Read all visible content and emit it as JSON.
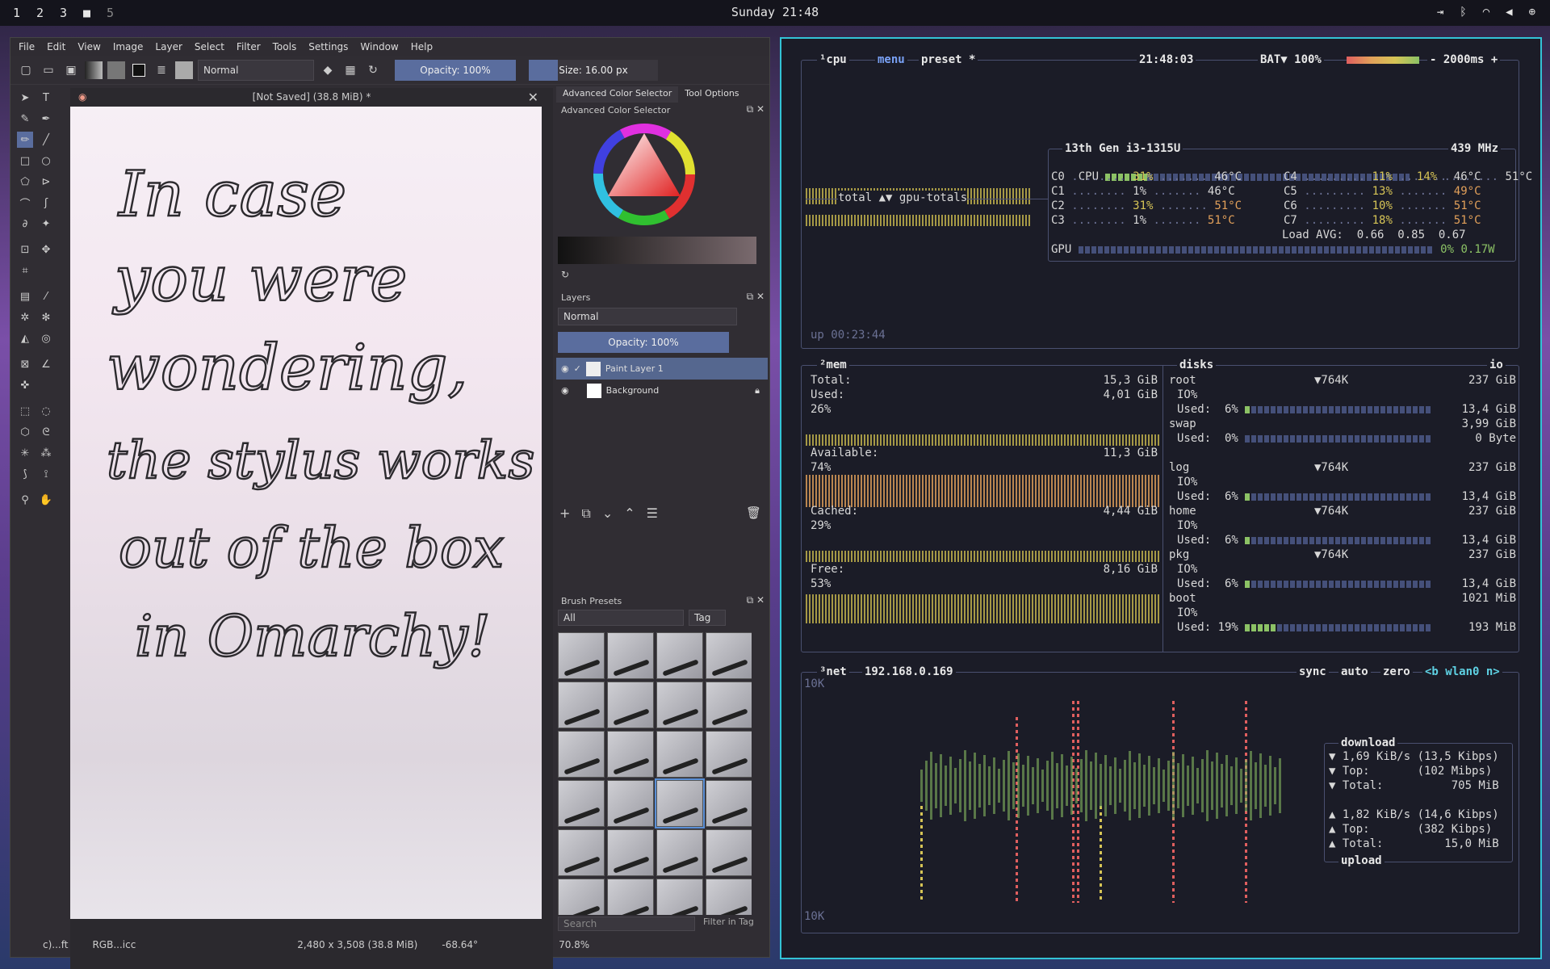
{
  "topbar": {
    "workspaces": [
      "1",
      "2",
      "3",
      "■",
      "5"
    ],
    "clock": "Sunday 21:48"
  },
  "krita": {
    "menu": [
      "File",
      "Edit",
      "View",
      "Image",
      "Layer",
      "Select",
      "Filter",
      "Tools",
      "Settings",
      "Window",
      "Help"
    ],
    "blend_mode": "Normal",
    "opacity": "Opacity: 100%",
    "size": "Size: 16.00 px",
    "doc_title": "[Not Saved]  (38.8 MiB) *",
    "handwriting": [
      "In case",
      "you were",
      "wondering,",
      "the stylus works",
      "out of the box",
      "in Omarchy!"
    ],
    "dock_tabs": [
      "Advanced Color Selector",
      "Tool Options"
    ],
    "color_selector_title": "Advanced Color Selector",
    "layers_title": "Layers",
    "layers_blend": "Normal",
    "layers_opacity": "Opacity:  100%",
    "layers": [
      {
        "name": "Paint Layer 1"
      },
      {
        "name": "Background"
      }
    ],
    "brush_title": "Brush Presets",
    "brush_filter": "All",
    "brush_tag": "Tag",
    "brush_search": "Search",
    "filter_in_tag": "Filter in Tag",
    "status": {
      "left": "c)...ft",
      "profile": "RGB...icc",
      "dims": "2,480 x 3,508 (38.8 MiB)",
      "angle": "-68.64°",
      "zoom": "70.8%"
    }
  },
  "btop": {
    "cpu": {
      "tabs": [
        "¹cpu",
        "menu",
        "preset *"
      ],
      "time": "21:48:03",
      "bat": "BAT▼ 100%",
      "interval": "- 2000ms +",
      "model": "13th Gen i3-1315U",
      "freq": "439 MHz",
      "total_label": "total ▲▼ gpu-totals",
      "cores": [
        {
          "n": "CPU",
          "p": "14%",
          "t": "51°C"
        },
        {
          "n": "C0",
          "p": "31%",
          "t": "46°C"
        },
        {
          "n": "C1",
          "p": "1%",
          "t": "46°C"
        },
        {
          "n": "C2",
          "p": "31%",
          "t": "51°C"
        },
        {
          "n": "C3",
          "p": "1%",
          "t": "51°C"
        },
        {
          "n": "C4",
          "p": "11%",
          "t": "46°C"
        },
        {
          "n": "C5",
          "p": "13%",
          "t": "49°C"
        },
        {
          "n": "C6",
          "p": "10%",
          "t": "51°C"
        },
        {
          "n": "C7",
          "p": "18%",
          "t": "51°C"
        }
      ],
      "load_label": "Load AVG:",
      "load": [
        "0.66",
        "0.85",
        "0.67"
      ],
      "gpu": "GPU",
      "gpu_pct": "0%",
      "gpu_w": "0.17W",
      "uptime": "up 00:23:44"
    },
    "mem": {
      "title": "²mem",
      "total_l": "Total:",
      "total": "15,3 GiB",
      "used_l": "Used:",
      "used": "4,01 GiB",
      "used_p": "26%",
      "avail_l": "Available:",
      "avail": "11,3 GiB",
      "avail_p": "74%",
      "cached_l": "Cached:",
      "cached": "4,44 GiB",
      "cached_p": "29%",
      "free_l": "Free:",
      "free": "8,16 GiB",
      "free_p": "53%"
    },
    "disks": {
      "title": "disks",
      "io": "io",
      "items": [
        {
          "name": "root",
          "io": "▼764K",
          "size": "237 GiB",
          "used": "Used:  6%",
          "u": "13,4 GiB"
        },
        {
          "name": "swap",
          "io": "",
          "size": "3,99 GiB",
          "used": "Used:  0%",
          "u": "0 Byte"
        },
        {
          "name": "log",
          "io": "▼764K",
          "size": "237 GiB",
          "used": "Used:  6%",
          "u": "13,4 GiB"
        },
        {
          "name": "home",
          "io": "▼764K",
          "size": "237 GiB",
          "used": "Used:  6%",
          "u": "13,4 GiB"
        },
        {
          "name": "pkg",
          "io": "▼764K",
          "size": "237 GiB",
          "used": "Used:  6%",
          "u": "13,4 GiB"
        },
        {
          "name": "boot",
          "io": "",
          "size": "1021 MiB",
          "used": "Used: 19%",
          "u": "193 MiB"
        }
      ],
      "io_label": "IO%"
    },
    "net": {
      "title": "³net",
      "ip": "192.168.0.169",
      "sync": "sync",
      "auto": "auto",
      "zero": "zero",
      "iface": "<b wlan0 n>",
      "scale_top": "10K",
      "scale_bot": "10K",
      "download": "download",
      "dl_rate": "▼ 1,69 KiB/s (13,5 Kibps)",
      "dl_top": "▼ Top:       (102 Mibps)",
      "dl_total": "▼ Total:          705 MiB",
      "ul_rate": "▲ 1,82 KiB/s (14,6 Kibps)",
      "ul_top": "▲ Top:       (382 Kibps)",
      "ul_total": "▲ Total:         15,0 MiB",
      "upload": "upload"
    }
  }
}
